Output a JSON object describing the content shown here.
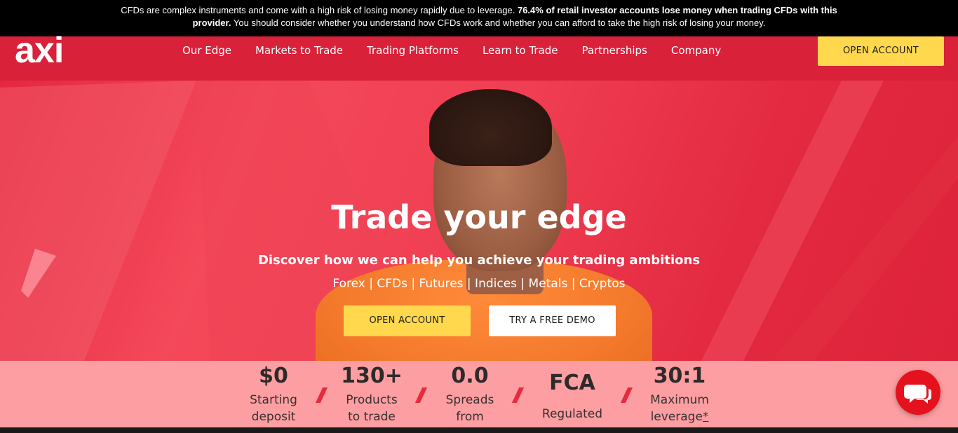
{
  "risk_warning": {
    "part1": "CFDs are complex instruments and come with a high risk of losing money rapidly due to leverage. ",
    "part2": "76.4% of retail investor accounts lose money when trading CFDs with this provider.",
    "part3": " You should consider whether you understand how CFDs work and whether you can afford to take the high risk of losing your money."
  },
  "header": {
    "logo_text": "axi",
    "nav": [
      {
        "label": "Our Edge"
      },
      {
        "label": "Markets to Trade"
      },
      {
        "label": "Trading Platforms"
      },
      {
        "label": "Learn to Trade"
      },
      {
        "label": "Partnerships"
      },
      {
        "label": "Company"
      }
    ],
    "cta_label": "OPEN ACCOUNT"
  },
  "hero": {
    "title": "Trade your edge",
    "subtitle": "Discover how we can help you achieve your trading ambitions",
    "markets": "Forex | CFDs | Futures | Indices | Metals | Cryptos",
    "primary_button": "OPEN ACCOUNT",
    "secondary_button": "TRY A FREE DEMO"
  },
  "stats": [
    {
      "value": "$0",
      "label_line1": "Starting",
      "label_line2": "deposit"
    },
    {
      "value": "130+",
      "label_line1": "Products",
      "label_line2": "to trade"
    },
    {
      "value": "0.0",
      "label_line1": "Spreads",
      "label_line2": "from"
    },
    {
      "value": "FCA",
      "label_line1": "Regulated",
      "label_line2": ""
    },
    {
      "value": "30:1",
      "label_line1": "Maximum",
      "label_line2": "leverage",
      "footnote": "*"
    }
  ],
  "colors": {
    "brand_red": "#e8273d",
    "header_red": "#d9213a",
    "cta_yellow": "#ffd84d",
    "chat_red": "#e5121e"
  },
  "icons": {
    "chat": "chat-bubbles-icon"
  }
}
